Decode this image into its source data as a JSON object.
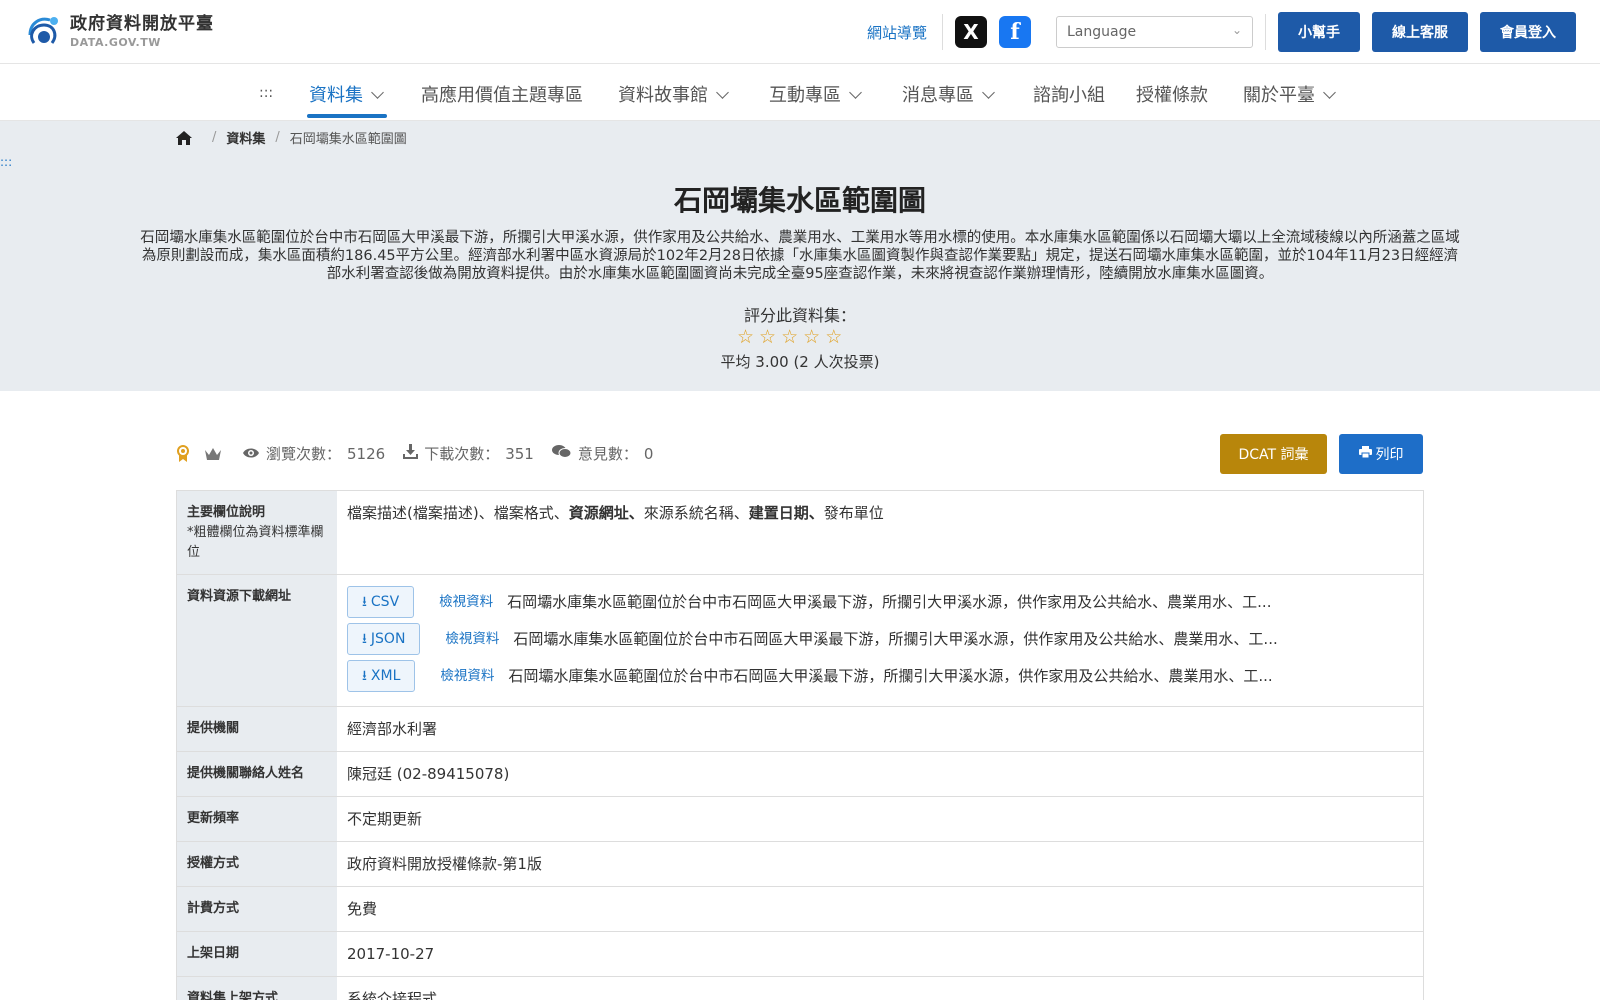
{
  "header": {
    "logo_zh": "政府資料開放平臺",
    "logo_en": "DATA.GOV.TW",
    "site_nav": "網站導覽",
    "social_x": "X",
    "social_fb": "f",
    "language_placeholder": "Language",
    "helper": "小幫手",
    "support": "線上客服",
    "login": "會員登入"
  },
  "nav": {
    "accesskey": ":::",
    "items": [
      "資料集",
      "高應用價值主題專區",
      "資料故事館",
      "互動專區",
      "消息專區",
      "諮詢小組",
      "授權條款",
      "關於平臺"
    ]
  },
  "breadcrumb": {
    "level1": "資料集",
    "level2": "石岡壩集水區範圍圖"
  },
  "hero": {
    "accesskey": ":::",
    "title": "石岡壩集水區範圍圖",
    "description": "石岡壩水庫集水區範圍位於台中市石岡區大甲溪最下游，所攔引大甲溪水源，供作家用及公共給水、農業用水、工業用水等用水標的使用。本水庫集水區範圍係以石岡壩大壩以上全流域稜線以內所涵蓋之區域為原則劃設而成，集水區面積約186.45平方公里。經濟部水利署中區水資源局於102年2月28日依據「水庫集水區圖資製作與查認作業要點」規定，提送石岡壩水庫集水區範圍，並於104年11月23日經經濟部水利署查認後做為開放資料提供。由於水庫集水區範圍圖資尚未完成全臺95座查認作業，未來將視查認作業辦理情形，陸續開放水庫集水區圖資。",
    "rate_label": "評分此資料集：",
    "rating_max": 5,
    "rating_filled": 0,
    "average": "平均 3.00 (2 人次投票)"
  },
  "stats": {
    "views_label": "瀏覽次數：",
    "views": "5126",
    "downloads_label": "下載次數：",
    "downloads": "351",
    "comments_label": "意見數：",
    "comments": "0",
    "dcat": "DCAT 詞彙",
    "print": "列印"
  },
  "table": {
    "main_fields_label": "主要欄位說明",
    "main_fields_note": "*粗體欄位為資料標準欄位",
    "main_fields": {
      "part1": "檔案描述(檔案描述)、檔案格式、",
      "bold1": "資源網址、",
      "part2": "來源系統名稱、",
      "bold2": "建置日期、",
      "part3": "發布單位"
    },
    "download_label": "資料資源下載網址",
    "resources": [
      {
        "format": "CSV",
        "view": "檢視資料",
        "desc": "石岡壩水庫集水區範圍位於台中市石岡區大甲溪最下游，所攔引大甲溪水源，供作家用及公共給水、農業用水、工..."
      },
      {
        "format": "JSON",
        "view": "檢視資料",
        "desc": "石岡壩水庫集水區範圍位於台中市石岡區大甲溪最下游，所攔引大甲溪水源，供作家用及公共給水、農業用水、工..."
      },
      {
        "format": "XML",
        "view": "檢視資料",
        "desc": "石岡壩水庫集水區範圍位於台中市石岡區大甲溪最下游，所攔引大甲溪水源，供作家用及公共給水、農業用水、工..."
      }
    ],
    "provider_label": "提供機關",
    "provider": "經濟部水利署",
    "contact_label": "提供機關聯絡人姓名",
    "contact": "陳冠廷 (02-89415078)",
    "frequency_label": "更新頻率",
    "frequency": "不定期更新",
    "license_label": "授權方式",
    "license": "政府資料開放授權條款-第1版",
    "fee_label": "計費方式",
    "fee": "免費",
    "date_label": "上架日期",
    "date": "2017-10-27",
    "method_label": "資料集上架方式",
    "method": "系統介接程式"
  },
  "colors": {
    "primary": "#1e5aa8",
    "link": "#1a73c4",
    "dcat": "#b8860b",
    "star": "#e0a020",
    "hero_bg": "#e8ecf0"
  }
}
